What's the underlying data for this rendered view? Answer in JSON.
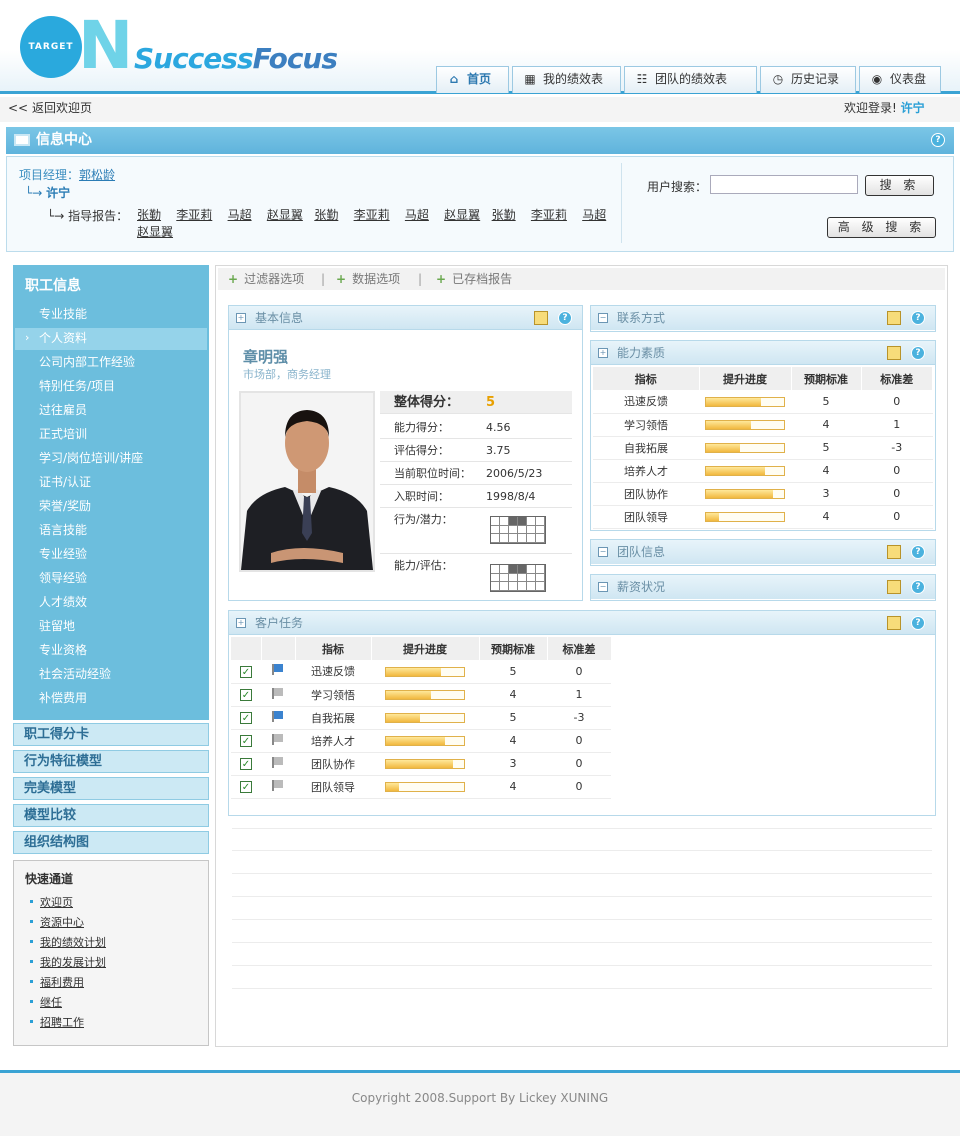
{
  "header": {
    "logo_target": "TARGET",
    "logo_n": "N",
    "logo_success": "Success",
    "logo_focus": "Focus",
    "nav": [
      "首页",
      "我的绩效表",
      "团队的绩效表",
      "历史记录",
      "仪表盘"
    ]
  },
  "topbar": {
    "back": "返回欢迎页",
    "welcome": "欢迎登录!",
    "user": "许宁"
  },
  "info": {
    "title": "信息中心",
    "pm_label": "项目经理：",
    "pm_name": "郭松龄",
    "sub_name": "许宁",
    "reports_label": "指导报告：",
    "reports": [
      "张勤",
      "李亚莉",
      "马超",
      "赵显翼",
      "张勤",
      "李亚莉",
      "马超",
      "赵显翼",
      "张勤",
      "李亚莉",
      "马超",
      "赵显翼"
    ],
    "search_label": "用户搜索：",
    "search_button": "搜 索",
    "adv_button": "高 级 搜 索"
  },
  "sidebar": {
    "title": "职工信息",
    "items": [
      "专业技能",
      "个人资料",
      "公司内部工作经验",
      "特别任务/项目",
      "过往雇员",
      "正式培训",
      "学习/岗位培训/讲座",
      "证书/认证",
      "荣誉/奖励",
      "语言技能",
      "专业经验",
      "领导经验",
      "人才绩效",
      "驻留地",
      "专业资格",
      "社会活动经验",
      "补偿费用"
    ],
    "selected_index": 1,
    "sections": [
      "职工得分卡",
      "行为特征模型",
      "完美模型",
      "模型比较",
      "组织结构图"
    ],
    "quick_title": "快速通道",
    "quick": [
      "欢迎页",
      "资源中心",
      "我的绩效计划",
      "我的发展计划",
      "福利费用",
      "继任",
      "招聘工作"
    ]
  },
  "tabs": [
    "过滤器选项",
    "数据选项",
    "已存档报告"
  ],
  "basic": {
    "title": "基本信息",
    "name": "章明强",
    "dept": "市场部，商务经理",
    "overall_label": "整体得分：",
    "overall": "5",
    "ability_label": "能力得分：",
    "ability": "4.56",
    "eval_label": "评估得分：",
    "eval": "3.75",
    "pos_label": "当前职位时间：",
    "pos": "2006/5/23",
    "join_label": "入职时间：",
    "join": "1998/8/4",
    "bp_label": "行为/潜力：",
    "ae_label": "能力/评估："
  },
  "panels": {
    "contact": "联系方式",
    "ability": "能力素质",
    "team": "团队信息",
    "salary": "薪资状况",
    "tasks": "客户任务"
  },
  "table_headers": [
    "指标",
    "提升进度",
    "预期标准",
    "标准差"
  ],
  "ability_rows": [
    {
      "name": "迅速反馈",
      "progress": 0.7,
      "expect": "5",
      "dev": "0"
    },
    {
      "name": "学习领悟",
      "progress": 0.58,
      "expect": "4",
      "dev": "1"
    },
    {
      "name": "自我拓展",
      "progress": 0.43,
      "expect": "5",
      "dev": "-3"
    },
    {
      "name": "培养人才",
      "progress": 0.75,
      "expect": "4",
      "dev": "0"
    },
    {
      "name": "团队协作",
      "progress": 0.86,
      "expect": "3",
      "dev": "0"
    },
    {
      "name": "团队领导",
      "progress": 0.17,
      "expect": "4",
      "dev": "0"
    }
  ],
  "task_rows": [
    {
      "name": "迅速反馈",
      "progress": 0.7,
      "expect": "5",
      "dev": "0",
      "flag": "blue"
    },
    {
      "name": "学习领悟",
      "progress": 0.58,
      "expect": "4",
      "dev": "1",
      "flag": "gray"
    },
    {
      "name": "自我拓展",
      "progress": 0.43,
      "expect": "5",
      "dev": "-3",
      "flag": "blue"
    },
    {
      "name": "培养人才",
      "progress": 0.75,
      "expect": "4",
      "dev": "0",
      "flag": "gray"
    },
    {
      "name": "团队协作",
      "progress": 0.86,
      "expect": "3",
      "dev": "0",
      "flag": "gray"
    },
    {
      "name": "团队领导",
      "progress": 0.17,
      "expect": "4",
      "dev": "0",
      "flag": "gray"
    }
  ],
  "footer": "Copyright 2008.Support By Lickey XUNING",
  "colors": {
    "accent": "#3aa3d4",
    "sidebar": "#6cbedd",
    "score": "#e8a000"
  }
}
